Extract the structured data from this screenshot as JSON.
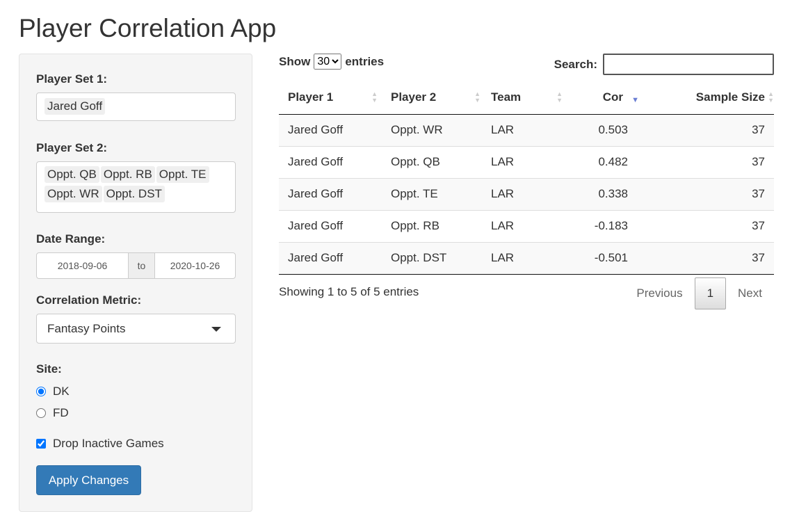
{
  "app": {
    "title": "Player Correlation App"
  },
  "sidebar": {
    "player_set_1": {
      "label": "Player Set 1:",
      "selected": [
        "Jared Goff"
      ]
    },
    "player_set_2": {
      "label": "Player Set 2:",
      "selected": [
        "Oppt. QB",
        "Oppt. RB",
        "Oppt. TE",
        "Oppt. WR",
        "Oppt. DST"
      ]
    },
    "date_range": {
      "label": "Date Range:",
      "start": "2018-09-06",
      "sep": "to",
      "end": "2020-10-26"
    },
    "metric": {
      "label": "Correlation Metric:",
      "value": "Fantasy Points"
    },
    "site": {
      "label": "Site:",
      "options": [
        "DK",
        "FD"
      ],
      "selected": "DK"
    },
    "drop_inactive": {
      "label": "Drop Inactive Games",
      "checked": true
    },
    "apply_label": "Apply Changes"
  },
  "table": {
    "show_label": "Show",
    "entries_value": "30",
    "entries_label": "entries",
    "search_label": "Search:",
    "search_value": "",
    "columns": [
      "Player 1",
      "Player 2",
      "Team",
      "Cor",
      "Sample Size"
    ],
    "sorted_column": "Cor",
    "sort_direction": "desc",
    "rows": [
      [
        "Jared Goff",
        "Oppt. WR",
        "LAR",
        "0.503",
        "37"
      ],
      [
        "Jared Goff",
        "Oppt. QB",
        "LAR",
        "0.482",
        "37"
      ],
      [
        "Jared Goff",
        "Oppt. TE",
        "LAR",
        "0.338",
        "37"
      ],
      [
        "Jared Goff",
        "Oppt. RB",
        "LAR",
        "-0.183",
        "37"
      ],
      [
        "Jared Goff",
        "Oppt. DST",
        "LAR",
        "-0.501",
        "37"
      ]
    ],
    "info": "Showing 1 to 5 of 5 entries",
    "pagination": {
      "previous": "Previous",
      "current": "1",
      "next": "Next"
    }
  },
  "colors": {
    "primary": "#337ab7",
    "sort_active": "#6a7ed3"
  }
}
